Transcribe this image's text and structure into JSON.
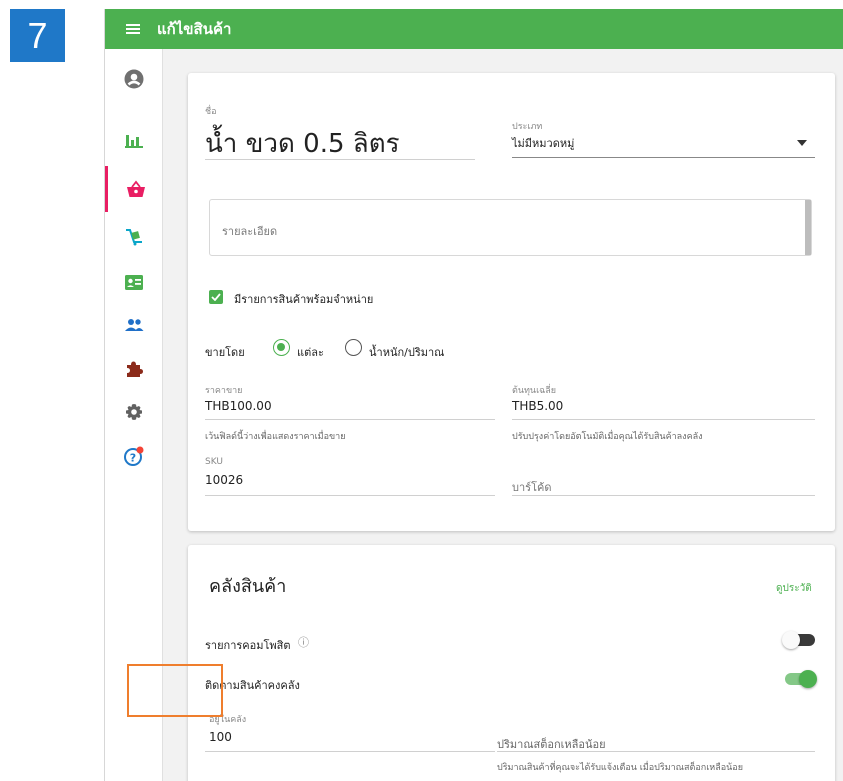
{
  "step_badge": "7",
  "header": {
    "title": "แก้ไขสินค้า"
  },
  "sidebar": {
    "items": [
      {
        "name": "account-icon"
      },
      {
        "name": "reports-icon"
      },
      {
        "name": "products-icon",
        "active": true
      },
      {
        "name": "inventory-icon"
      },
      {
        "name": "employees-icon"
      },
      {
        "name": "customers-icon"
      },
      {
        "name": "integrations-icon"
      },
      {
        "name": "settings-icon"
      },
      {
        "name": "help-icon"
      }
    ]
  },
  "item": {
    "name_label": "ชื่อ",
    "name_value": "น้ำ ขวด 0.5 ลิตร",
    "category_label": "ประเภท",
    "category_value": "ไม่มีหมวดหมู่",
    "description_placeholder": "รายละเอียด",
    "available_for_sale": "มีรายการสินค้าพร้อมจำหน่าย",
    "sold_by_label": "ขายโดย",
    "sold_by_each": "แต่ละ",
    "sold_by_weight": "น้ำหนัก/ปริมาณ",
    "price_label": "ราคาขาย",
    "price_value": "THB100.00",
    "price_help": "เว้นฟิลด์นี้ว่างเพื่อแสดงราคาเมื่อขาย",
    "cost_label": "ต้นทุนเฉลี่ย",
    "cost_value": "THB5.00",
    "cost_help": "ปรับปรุงค่าโดยอัตโนมัติเมื่อคุณได้รับสินค้าลงคลัง",
    "sku_label": "SKU",
    "sku_value": "10026",
    "barcode_placeholder": "บาร์โค้ด"
  },
  "inventory": {
    "title": "คลังสินค้า",
    "history_link": "ดูประวัติ",
    "composite_label": "รายการคอมโพสิต",
    "composite_info_icon": "ⓘ",
    "track_stock_label": "ติดตามสินค้าคงคลัง",
    "in_stock_label": "อยู่ในคลัง",
    "in_stock_value": "100",
    "low_stock_label": "ปริมาณสต็อกเหลือน้อย",
    "low_stock_help": "ปริมาณสินค้าที่คุณจะได้รับแจ้งเตือน เมื่อปริมาณสต็อกเหลือน้อย"
  },
  "colors": {
    "header_green": "#4cb050",
    "accent_pink": "#e91e63",
    "badge_blue": "#1f78c8",
    "highlight_orange": "#ef7e2d"
  }
}
